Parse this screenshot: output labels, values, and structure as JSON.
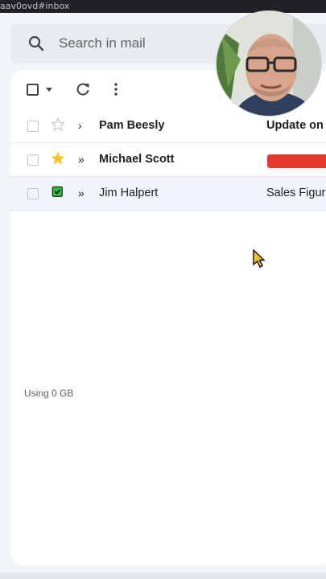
{
  "browser": {
    "url_fragment": "aav0ovd#inbox"
  },
  "search": {
    "placeholder": "Search in mail"
  },
  "toolbar": {
    "icons": [
      "checkbox",
      "chevron-down-icon",
      "refresh-icon",
      "more-vert-icon"
    ]
  },
  "emails": [
    {
      "sender": "Pam Beesly",
      "subject": "Update on",
      "starred": false,
      "unread": true,
      "importance": "›",
      "label_color": null
    },
    {
      "sender": "Michael Scott",
      "subject": "",
      "starred": true,
      "unread": true,
      "importance": "»",
      "label_color": "#e5392f"
    },
    {
      "sender": "Jim Halpert",
      "subject": "Sales Figur",
      "starred": false,
      "unread": false,
      "importance": "»",
      "tag_color": "#23c13a"
    }
  ],
  "footer": {
    "storage": "Using 0 GB"
  },
  "colors": {
    "accent_red": "#e5392f",
    "accent_green": "#23c13a",
    "star_yellow": "#f4c430"
  }
}
